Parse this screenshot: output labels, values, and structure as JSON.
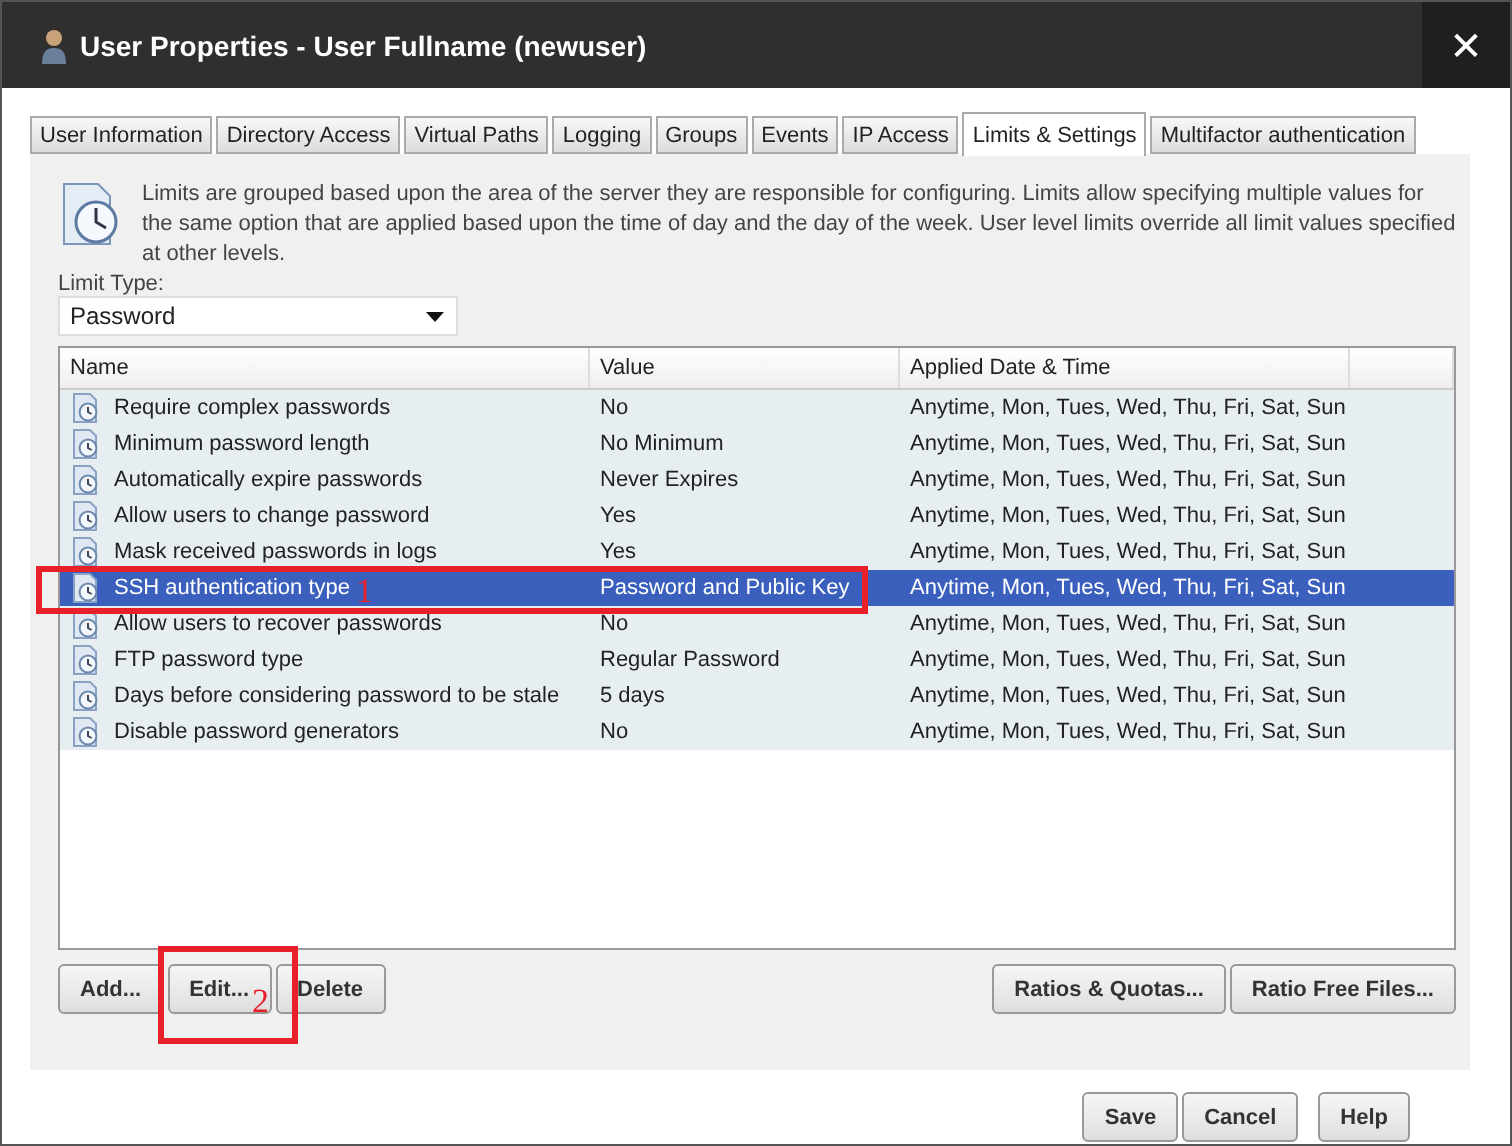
{
  "window": {
    "title": "User Properties - User Fullname (newuser)",
    "close": "✕"
  },
  "tabs": [
    {
      "label": "User Information",
      "selected": false
    },
    {
      "label": "Directory Access",
      "selected": false
    },
    {
      "label": "Virtual Paths",
      "selected": false
    },
    {
      "label": "Logging",
      "selected": false
    },
    {
      "label": "Groups",
      "selected": false
    },
    {
      "label": "Events",
      "selected": false
    },
    {
      "label": "IP Access",
      "selected": false
    },
    {
      "label": "Limits & Settings",
      "selected": true
    },
    {
      "label": "Multifactor authentication",
      "selected": false
    }
  ],
  "description": "Limits are grouped based upon the area of the server they are responsible for configuring. Limits allow specifying multiple values for the same option that are applied based upon the time of day and the day of the week. User level limits override all limit values specified at other levels.",
  "limit_type": {
    "label": "Limit Type:",
    "value": "Password"
  },
  "table": {
    "columns": [
      "Name",
      "Value",
      "Applied Date & Time"
    ],
    "rows": [
      {
        "name": "Require complex passwords",
        "value": "No",
        "applied": "Anytime, Mon, Tues, Wed, Thu, Fri, Sat, Sun",
        "selected": false
      },
      {
        "name": "Minimum password length",
        "value": "No Minimum",
        "applied": "Anytime, Mon, Tues, Wed, Thu, Fri, Sat, Sun",
        "selected": false
      },
      {
        "name": "Automatically expire passwords",
        "value": "Never Expires",
        "applied": "Anytime, Mon, Tues, Wed, Thu, Fri, Sat, Sun",
        "selected": false
      },
      {
        "name": "Allow users to change password",
        "value": "Yes",
        "applied": "Anytime, Mon, Tues, Wed, Thu, Fri, Sat, Sun",
        "selected": false
      },
      {
        "name": "Mask received passwords in logs",
        "value": "Yes",
        "applied": "Anytime, Mon, Tues, Wed, Thu, Fri, Sat, Sun",
        "selected": false
      },
      {
        "name": "SSH authentication type",
        "value": "Password and Public Key",
        "applied": "Anytime, Mon, Tues, Wed, Thu, Fri, Sat, Sun",
        "selected": true
      },
      {
        "name": "Allow users to recover passwords",
        "value": "No",
        "applied": "Anytime, Mon, Tues, Wed, Thu, Fri, Sat, Sun",
        "selected": false
      },
      {
        "name": "FTP password type",
        "value": "Regular Password",
        "applied": "Anytime, Mon, Tues, Wed, Thu, Fri, Sat, Sun",
        "selected": false
      },
      {
        "name": "Days before considering password to be stale",
        "value": "5 days",
        "applied": "Anytime, Mon, Tues, Wed, Thu, Fri, Sat, Sun",
        "selected": false
      },
      {
        "name": "Disable password generators",
        "value": "No",
        "applied": "Anytime, Mon, Tues, Wed, Thu, Fri, Sat, Sun",
        "selected": false
      }
    ]
  },
  "list_buttons": [
    "Add...",
    "Edit...",
    "Delete"
  ],
  "extra_buttons": [
    "Ratios & Quotas...",
    "Ratio Free Files..."
  ],
  "footer_buttons": [
    "Save",
    "Cancel"
  ],
  "help_button": "Help",
  "annotations": [
    {
      "label": "1"
    },
    {
      "label": "2"
    }
  ]
}
